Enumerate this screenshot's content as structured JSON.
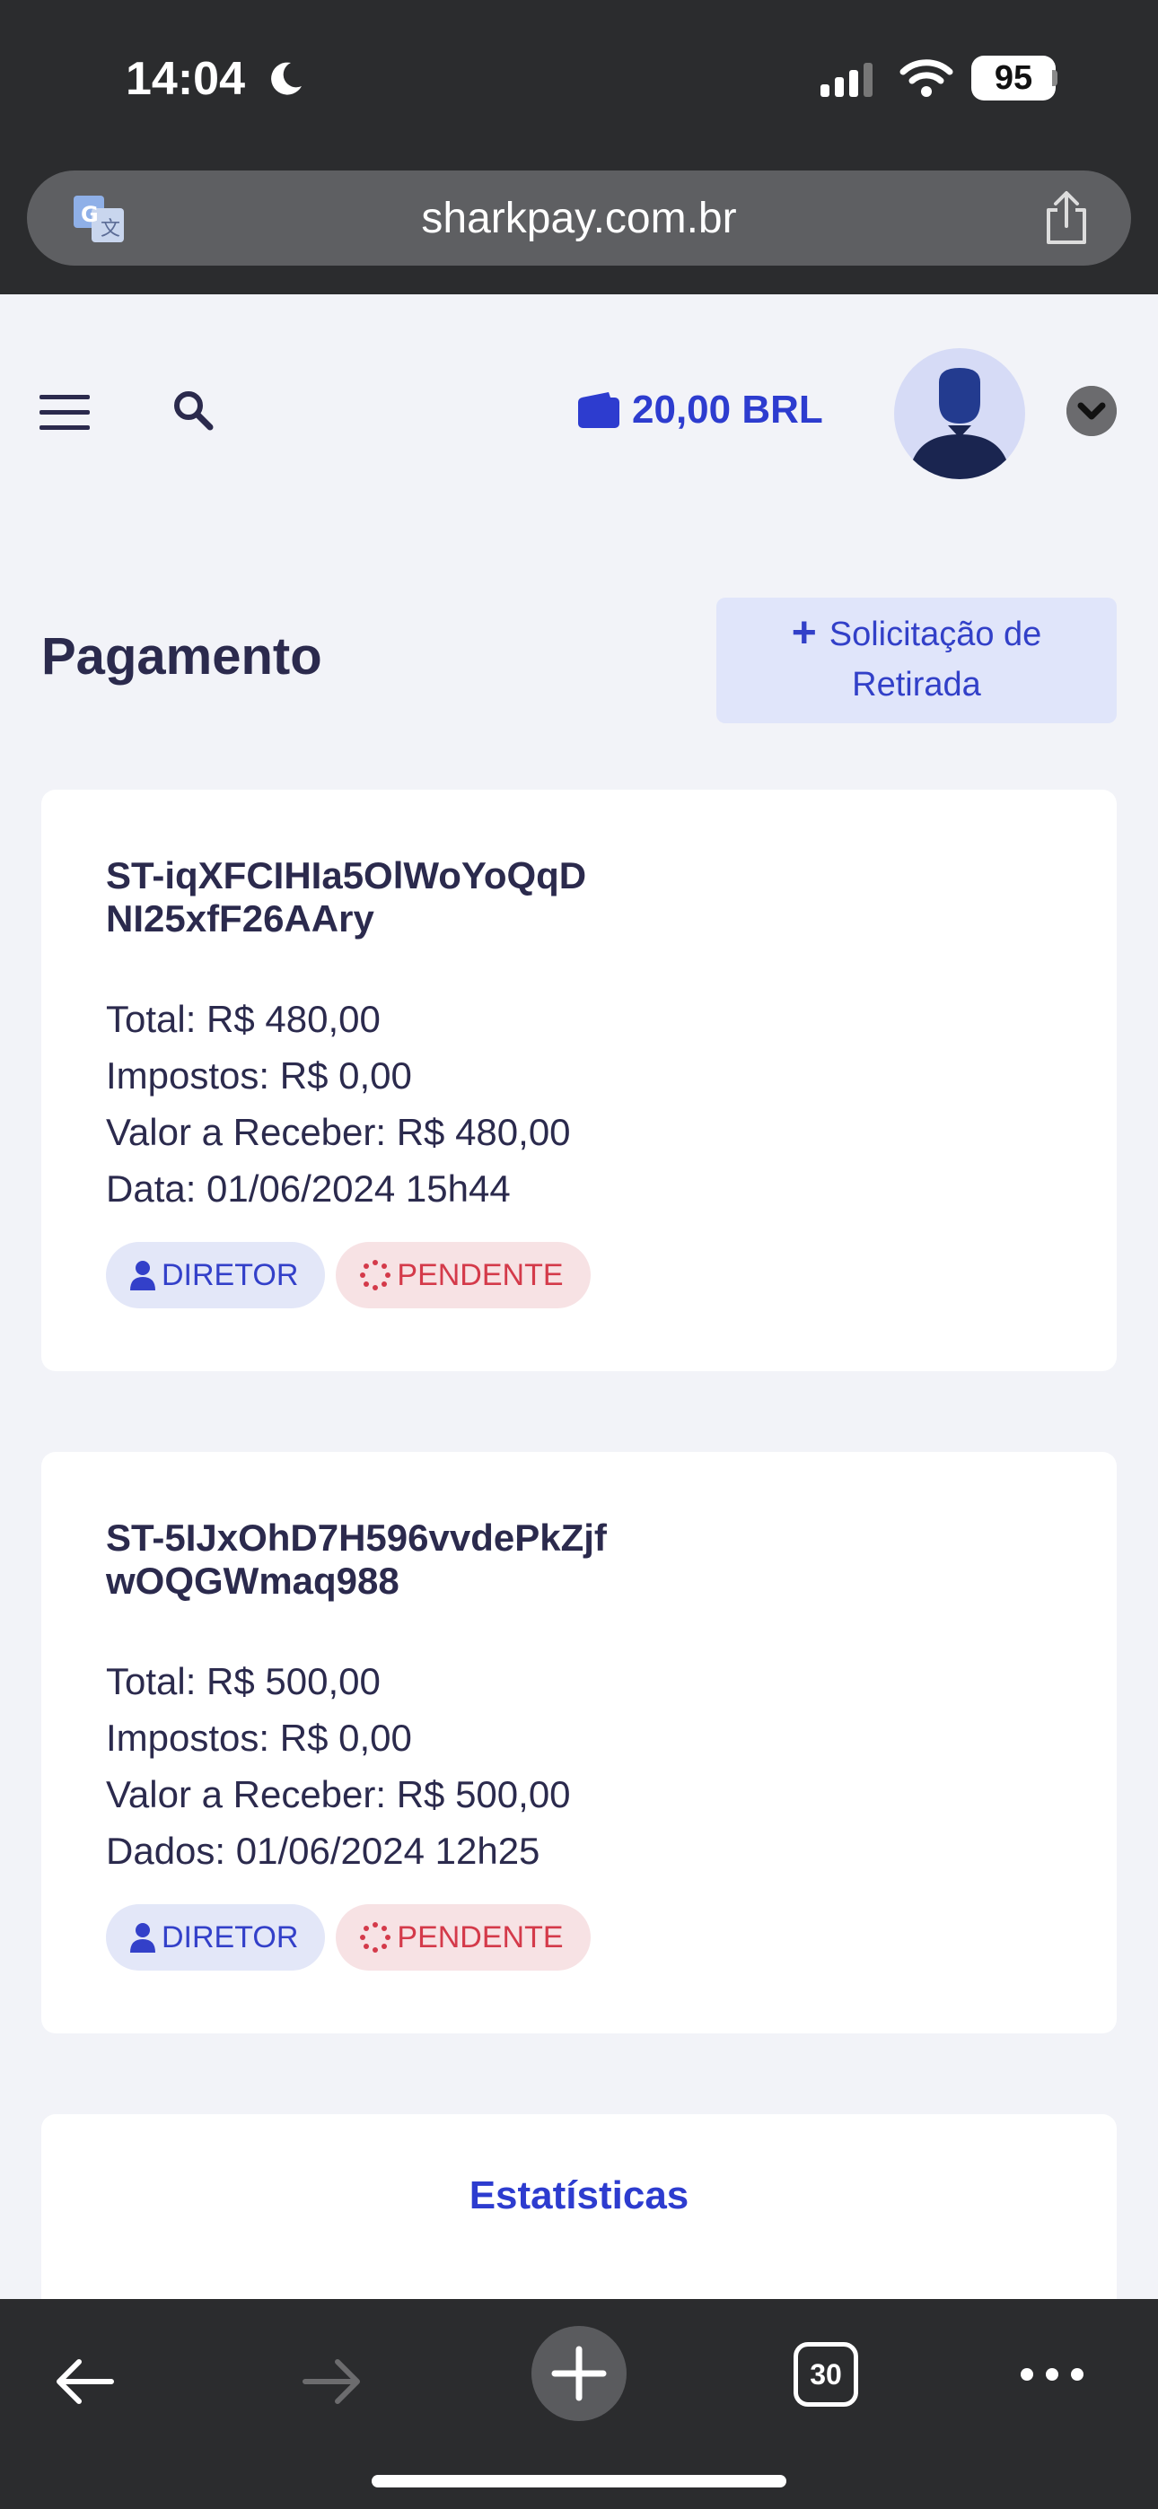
{
  "status_bar": {
    "time": "14:04",
    "battery": "95"
  },
  "browser": {
    "url": "sharkpay.com.br",
    "tab_count": "30"
  },
  "header": {
    "balance": "20,00 BRL"
  },
  "page": {
    "title": "Pagamento",
    "withdraw_button_line1": "Solicitação de",
    "withdraw_button_line2": "Retirada"
  },
  "payments": [
    {
      "id": "ST-iqXFCIHIa5OlWoYoQqDNI25xfF26AAry",
      "total": "Total: R$ 480,00",
      "taxes": "Impostos: R$ 0,00",
      "receive": "Valor a Receber: R$ 480,00",
      "date": "Data: 01/06/2024 15h44",
      "role_badge": "DIRETOR",
      "status_badge": "PENDENTE"
    },
    {
      "id": "ST-5IJxOhD7H596vvdePkZjfwOQGWmaq988",
      "total": "Total: R$ 500,00",
      "taxes": "Impostos: R$ 0,00",
      "receive": "Valor a Receber: R$ 500,00",
      "date": "Dados: 01/06/2024 12h25",
      "role_badge": "DIRETOR",
      "status_badge": "PENDENTE"
    }
  ],
  "stats": {
    "title": "Estatísticas",
    "subtitle": ""
  },
  "colors": {
    "accent": "#2d3ccf",
    "pending": "#d43a4a",
    "text": "#2b2a4d"
  }
}
